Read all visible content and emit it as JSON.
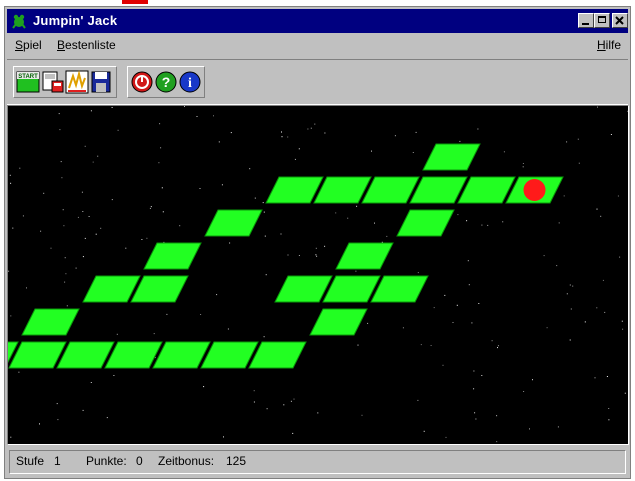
{
  "window": {
    "title": "Jumpin' Jack"
  },
  "menu": {
    "spiel_u": "S",
    "spiel_rest": "piel",
    "bestenliste_u": "B",
    "bestenliste_rest": "estenliste",
    "hilfe_u": "H",
    "hilfe_rest": "ilfe"
  },
  "toolbar": {
    "start_text": "START",
    "help_text": "?",
    "info_text": "i"
  },
  "status": {
    "stufe_label": "Stufe",
    "stufe_value": "1",
    "punkte_label": "Punkte:",
    "punkte_value": "0",
    "zeitbonus_label": "Zeitbonus:",
    "zeitbonus_value": "125"
  },
  "colors": {
    "titlebar": "#000080",
    "tile": "#22ff22",
    "tile_edge": "#0a9a0a",
    "player": "#ff1a1a",
    "board_bg": "#000000"
  }
}
